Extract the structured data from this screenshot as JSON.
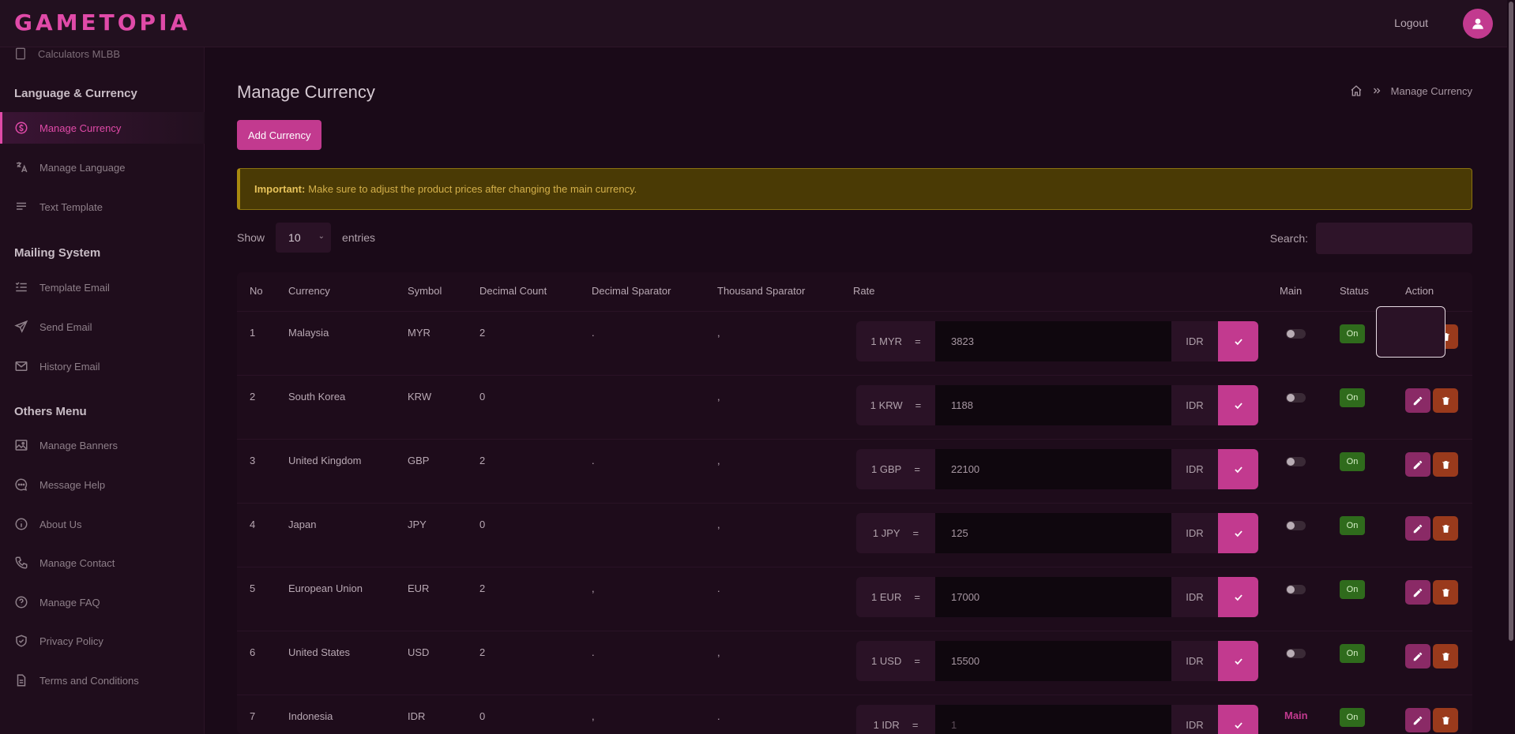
{
  "brand": {
    "logo": "GAMETOPIA",
    "accent": "#c23a8f"
  },
  "topbar": {
    "logout": "Logout",
    "avatar_icon": "user-icon"
  },
  "sidebar": {
    "cut_item": "Calculators MLBB",
    "sections": [
      {
        "title": "Language & Currency",
        "items": [
          {
            "label": "Manage Currency",
            "icon": "currency-icon",
            "active": true
          },
          {
            "label": "Manage Language",
            "icon": "translate-icon"
          },
          {
            "label": "Text Template",
            "icon": "text-icon"
          }
        ]
      },
      {
        "title": "Mailing System",
        "items": [
          {
            "label": "Template Email",
            "icon": "list-icon"
          },
          {
            "label": "Send Email",
            "icon": "send-icon"
          },
          {
            "label": "History Email",
            "icon": "mail-icon"
          }
        ]
      },
      {
        "title": "Others Menu",
        "items": [
          {
            "label": "Manage Banners",
            "icon": "image-icon"
          },
          {
            "label": "Message Help",
            "icon": "chat-icon"
          },
          {
            "label": "About Us",
            "icon": "info-icon"
          },
          {
            "label": "Manage Contact",
            "icon": "phone-icon"
          },
          {
            "label": "Manage FAQ",
            "icon": "help-icon"
          },
          {
            "label": "Privacy Policy",
            "icon": "shield-icon"
          },
          {
            "label": "Terms and Conditions",
            "icon": "document-icon"
          }
        ]
      }
    ]
  },
  "page": {
    "title": "Manage Currency",
    "breadcrumb": "Manage Currency",
    "add_button": "Add Currency",
    "alert_strong": "Important:",
    "alert_text": "Make sure to adjust the product prices after changing the main currency.",
    "show_label": "Show",
    "show_value": "10",
    "entries_label": "entries",
    "search_label": "Search:"
  },
  "table": {
    "headers": [
      "No",
      "Currency",
      "Symbol",
      "Decimal Count",
      "Decimal Sparator",
      "Thousand Sparator",
      "Rate",
      "Main",
      "Status",
      "Action"
    ],
    "rows": [
      {
        "no": "1",
        "currency": "Malaysia",
        "symbol": "MYR",
        "decimal_count": "2",
        "decimal_sep": ".",
        "thousand_sep": ",",
        "rate_prefix": "1 MYR",
        "eq": "=",
        "rate": "3823",
        "rate_suffix": "IDR",
        "main": "",
        "status": "On"
      },
      {
        "no": "2",
        "currency": "South Korea",
        "symbol": "KRW",
        "decimal_count": "0",
        "decimal_sep": "",
        "thousand_sep": ",",
        "rate_prefix": "1 KRW",
        "eq": "=",
        "rate": "1188",
        "rate_suffix": "IDR",
        "main": "",
        "status": "On"
      },
      {
        "no": "3",
        "currency": "United Kingdom",
        "symbol": "GBP",
        "decimal_count": "2",
        "decimal_sep": ".",
        "thousand_sep": ",",
        "rate_prefix": "1 GBP",
        "eq": "=",
        "rate": "22100",
        "rate_suffix": "IDR",
        "main": "",
        "status": "On"
      },
      {
        "no": "4",
        "currency": "Japan",
        "symbol": "JPY",
        "decimal_count": "0",
        "decimal_sep": "",
        "thousand_sep": ",",
        "rate_prefix": "1 JPY",
        "eq": "=",
        "rate": "125",
        "rate_suffix": "IDR",
        "main": "",
        "status": "On"
      },
      {
        "no": "5",
        "currency": "European Union",
        "symbol": "EUR",
        "decimal_count": "2",
        "decimal_sep": ",",
        "thousand_sep": ".",
        "rate_prefix": "1 EUR",
        "eq": "=",
        "rate": "17000",
        "rate_suffix": "IDR",
        "main": "",
        "status": "On"
      },
      {
        "no": "6",
        "currency": "United States",
        "symbol": "USD",
        "decimal_count": "2",
        "decimal_sep": ".",
        "thousand_sep": ",",
        "rate_prefix": "1 USD",
        "eq": "=",
        "rate": "15500",
        "rate_suffix": "IDR",
        "main": "",
        "status": "On"
      },
      {
        "no": "7",
        "currency": "Indonesia",
        "symbol": "IDR",
        "decimal_count": "0",
        "decimal_sep": ",",
        "thousand_sep": ".",
        "rate_prefix": "1 IDR",
        "eq": "=",
        "rate": "1",
        "rate_suffix": "IDR",
        "main": "Main",
        "status": "On"
      }
    ]
  }
}
